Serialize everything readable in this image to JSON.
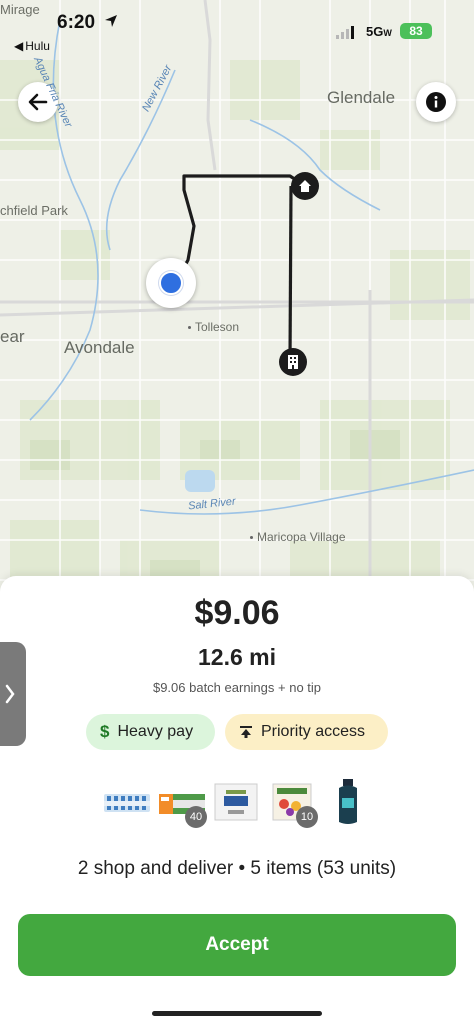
{
  "status_bar": {
    "time": "6:20",
    "back_app": "Hulu",
    "network": "5G",
    "network_suffix": "W",
    "battery": "83"
  },
  "map": {
    "labels": {
      "mirage": "Mirage",
      "glendale": "Glendale",
      "litchfield_park": "chfield Park",
      "avondale": "Avondale",
      "tolleson": "Tolleson",
      "avondale_left": "ear",
      "maricopa_village": "Maricopa Village",
      "agua_fria_river": "Agua Fria River",
      "new_river": "New River",
      "salt_river": "Salt River"
    },
    "icons": {
      "back": "back-arrow-icon",
      "info": "info-icon",
      "home_pin": "home-icon",
      "store_pin": "building-icon",
      "current_location": "location-dot-icon"
    },
    "route_color": "#1c1c1c"
  },
  "offer": {
    "price": "$9.06",
    "distance": "12.6 mi",
    "earnings_note": "$9.06 batch earnings + no tip",
    "badges": {
      "heavy_pay": "Heavy pay",
      "priority_access": "Priority access"
    },
    "item_counts": {
      "drinks": "40",
      "fruit_pack": "10"
    },
    "summary": "2 shop and deliver • 5 items (53 units)",
    "accept_label": "Accept"
  },
  "colors": {
    "accent_green": "#43a83f",
    "heavy_pay_bg": "#dcf5dc",
    "priority_bg": "#fcefc6",
    "location_blue": "#2f6fe0"
  }
}
